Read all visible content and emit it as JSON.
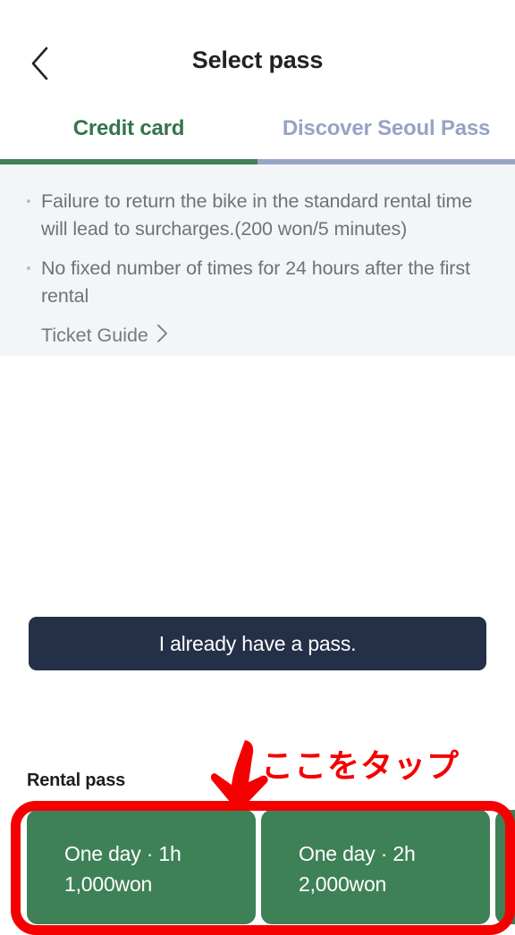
{
  "header": {
    "title": "Select pass",
    "back_icon": "chevron-left-icon"
  },
  "tabs": [
    {
      "label": "Credit card",
      "active": true
    },
    {
      "label": "Discover Seoul Pass",
      "active": false
    }
  ],
  "info": {
    "bullets": [
      "Failure to return the bike in the standard rental time will lead to surcharges.(200 won/5 minutes)",
      "No fixed number of times for 24 hours after the first rental"
    ],
    "ticket_guide_label": "Ticket Guide",
    "ticket_guide_chevron": "chevron-right-icon"
  },
  "pass_section": {
    "label": "Rental pass",
    "cards": [
      {
        "title": "One day · 1h",
        "price": "1,000won"
      },
      {
        "title": "One day · 2h",
        "price": "2,000won"
      },
      {
        "title": "",
        "price": ""
      }
    ]
  },
  "annotation": {
    "text": "ここをタップ",
    "arrow_icon": "down-arrow-icon",
    "color": "#f50000"
  },
  "footer": {
    "have_pass_label": "I already have a pass."
  },
  "colors": {
    "accent_green": "#3e8157",
    "tab_active_text": "#34744b",
    "tab_inactive_text": "#97a3c4",
    "tab_inactive_underline": "#9aa5c4",
    "panel_bg": "#f4f5f7",
    "button_navy": "#233048",
    "annotation_red": "#f50000"
  }
}
